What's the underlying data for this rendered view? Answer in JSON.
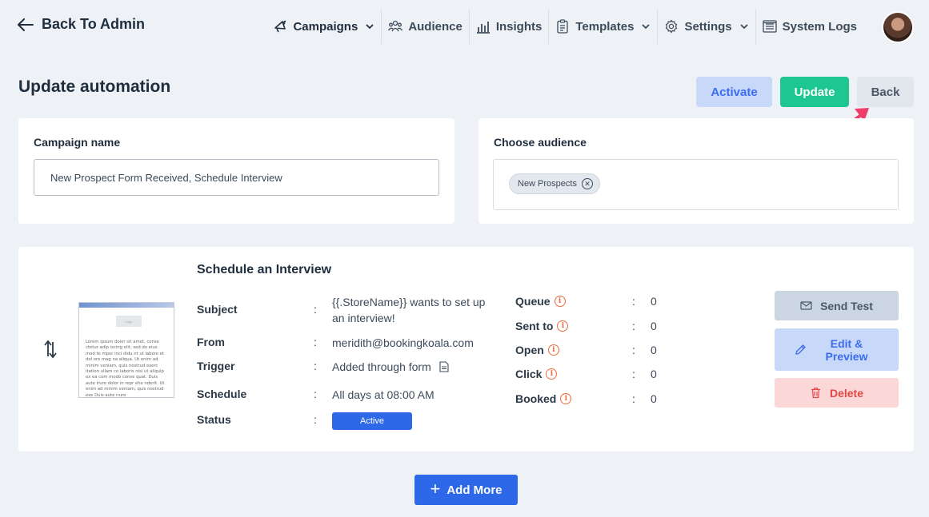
{
  "header": {
    "back_label": "Back To Admin",
    "nav": [
      {
        "label": "Campaigns",
        "icon": "megaphone-icon",
        "dropdown": true
      },
      {
        "label": "Audience",
        "icon": "users-icon",
        "dropdown": false
      },
      {
        "label": "Insights",
        "icon": "bar-chart-icon",
        "dropdown": false
      },
      {
        "label": "Templates",
        "icon": "clipboard-icon",
        "dropdown": true
      },
      {
        "label": "Settings",
        "icon": "gear-icon",
        "dropdown": true
      },
      {
        "label": "System Logs",
        "icon": "list-icon",
        "dropdown": false
      }
    ]
  },
  "page": {
    "title": "Update automation",
    "activate_label": "Activate",
    "update_label": "Update",
    "back_label": "Back"
  },
  "campaign": {
    "label": "Campaign name",
    "value": "New Prospect Form Received, Schedule Interview"
  },
  "audience": {
    "label": "Choose audience",
    "chips": [
      "New Prospects"
    ]
  },
  "step": {
    "title": "Schedule an Interview",
    "fields": {
      "subject_label": "Subject",
      "subject_value": "{{.StoreName}} wants to set up an interview!",
      "from_label": "From",
      "from_value": "meridith@bookingkoala.com",
      "trigger_label": "Trigger",
      "trigger_value": "Added through form",
      "schedule_label": "Schedule",
      "schedule_value": "All days at 08:00 AM",
      "status_label": "Status",
      "status_value": "Active"
    },
    "stats": [
      {
        "label": "Queue",
        "value": "0"
      },
      {
        "label": "Sent to",
        "value": "0"
      },
      {
        "label": "Open",
        "value": "0"
      },
      {
        "label": "Click",
        "value": "0"
      },
      {
        "label": "Booked",
        "value": "0"
      }
    ],
    "actions": {
      "send_test": "Send Test",
      "edit_preview": "Edit & Preview",
      "delete": "Delete"
    },
    "thumbnail": {
      "logo_text": "Logo",
      "body_text": "Lorem ipsum dolor sit amet, conse ctetur adip iscing elit, sed do eius mod te mpor inci didu nt ut labore et dol ore mag na aliqua. Ut enim ad minim veniam, quis nostrud exerc itation ullam co laboris nisi ut aliquip ex ea com modo conse quat. Duis aute irure dolor in repr ehe nderit. Ut enim ad minim veniam, quis nostrud exe Duis aute irure"
    }
  },
  "footer": {
    "add_more_label": "Add More"
  },
  "colors": {
    "primary": "#2c68e8",
    "success": "#1ec690",
    "danger": "#e24848",
    "info_orange": "#f06a3c",
    "annotation_arrow": "#ef3e6c"
  }
}
